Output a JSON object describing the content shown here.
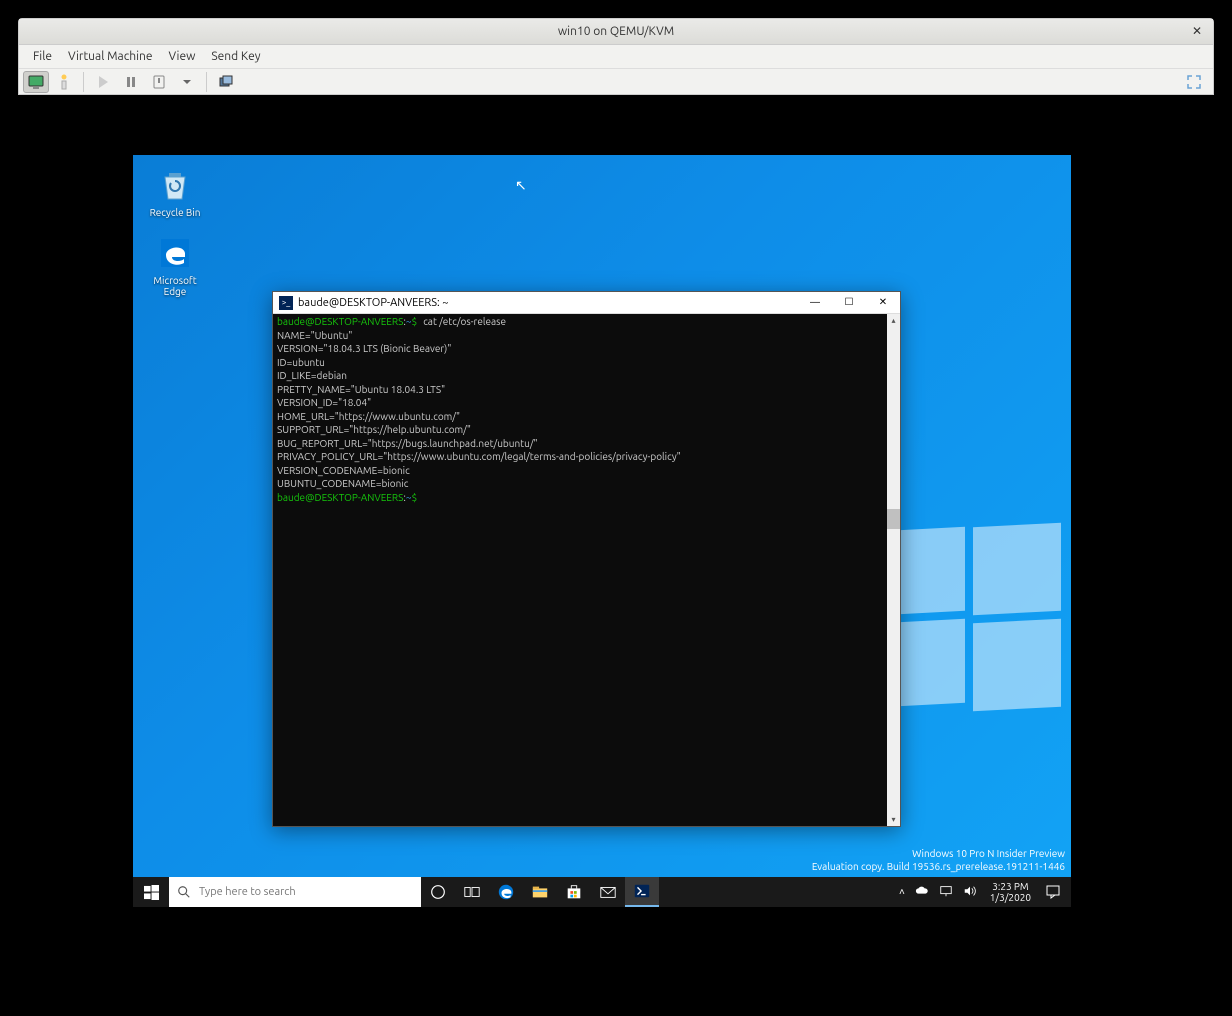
{
  "vmm": {
    "title": "win10 on QEMU/KVM",
    "menu": {
      "file": "File",
      "vm": "Virtual Machine",
      "view": "View",
      "sendkey": "Send Key"
    }
  },
  "desktop": {
    "icons": {
      "recycle": "Recycle Bin",
      "edge": "Microsoft Edge"
    },
    "watermark_line1": "Windows 10 Pro N Insider Preview",
    "watermark_line2": "Evaluation copy. Build 19536.rs_prerelease.191211-1446"
  },
  "taskbar": {
    "search_placeholder": "Type here to search",
    "time": "3:23 PM",
    "date": "1/3/2020"
  },
  "terminal": {
    "title": "baude@DESKTOP-ANVEERS: ~",
    "prompt_user": "baude@DESKTOP-ANVEERS",
    "prompt_sep": ":",
    "prompt_path": "~",
    "prompt_dollar": "$",
    "cmd": "cat /etc/os-release",
    "out": {
      "l1": "NAME=\"Ubuntu\"",
      "l2": "VERSION=\"18.04.3 LTS (Bionic Beaver)\"",
      "l3": "ID=ubuntu",
      "l4": "ID_LIKE=debian",
      "l5": "PRETTY_NAME=\"Ubuntu 18.04.3 LTS\"",
      "l6": "VERSION_ID=\"18.04\"",
      "l7": "HOME_URL=\"https://www.ubuntu.com/\"",
      "l8": "SUPPORT_URL=\"https://help.ubuntu.com/\"",
      "l9": "BUG_REPORT_URL=\"https://bugs.launchpad.net/ubuntu/\"",
      "l10": "PRIVACY_POLICY_URL=\"https://www.ubuntu.com/legal/terms-and-policies/privacy-policy\"",
      "l11": "VERSION_CODENAME=bionic",
      "l12": "UBUNTU_CODENAME=bionic"
    }
  }
}
